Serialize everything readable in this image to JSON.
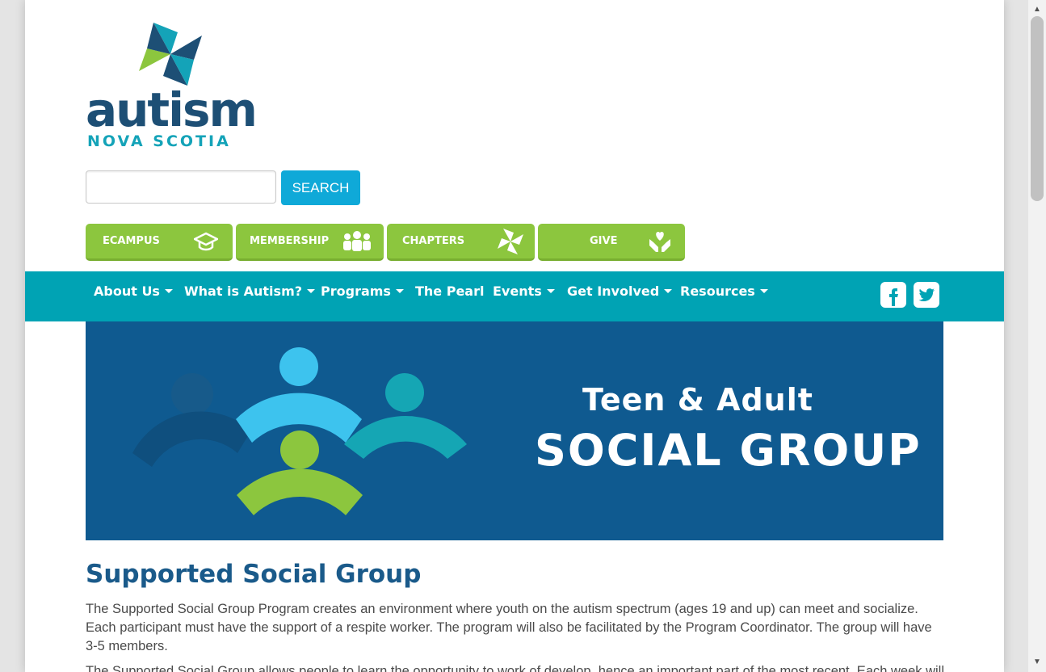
{
  "logo": {
    "word": "autism",
    "subword": "NOVA SCOTIA"
  },
  "search": {
    "value": "",
    "button_label": "SEARCH"
  },
  "quicklinks": [
    {
      "label": "ECAMPUS",
      "icon": "graduation-cap-icon"
    },
    {
      "label": "MEMBERSHIP",
      "icon": "people-icon"
    },
    {
      "label": "CHAPTERS",
      "icon": "pinwheel-icon"
    },
    {
      "label": "GIVE",
      "icon": "heart-hands-icon"
    }
  ],
  "nav": {
    "items": [
      {
        "label": "About Us",
        "dropdown": true
      },
      {
        "label": "What is Autism?",
        "dropdown": true
      },
      {
        "label": "Programs",
        "dropdown": true
      },
      {
        "label": "The Pearl",
        "dropdown": false
      },
      {
        "label": "Events",
        "dropdown": true
      },
      {
        "label": "Get Involved",
        "dropdown": true
      },
      {
        "label": "Resources",
        "dropdown": true
      }
    ],
    "social": [
      "facebook-icon",
      "twitter-icon"
    ]
  },
  "banner": {
    "line1": "Teen & Adult",
    "line2": "SOCIAL GROUP"
  },
  "content": {
    "title": "Supported Social Group",
    "paragraph1": "The Supported Social Group Program creates an environment where youth on the autism spectrum (ages 19 and up) can meet and socialize. Each participant must have the support of a respite worker. The program will also be facilitated by the Program Coordinator. The group will have 3-5 members.",
    "paragraph2": "The Supported Social Group allows people to learn the opportunity to work of develop, hence an important part of the most recent. Each week will"
  },
  "colors": {
    "nav": "#00a3b4",
    "quicklink": "#8cc63e",
    "search_button": "#0fa9d8",
    "title": "#1a5a8a",
    "banner": "#0f5a90"
  }
}
